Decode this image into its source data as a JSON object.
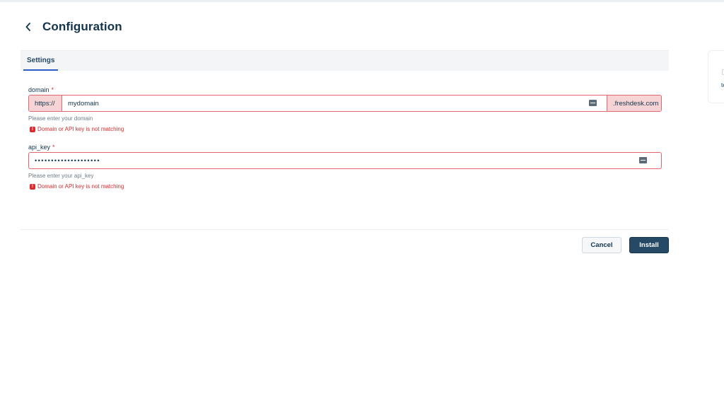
{
  "header": {
    "title": "Configuration",
    "back_icon": "chevron-left-icon"
  },
  "tabs": [
    {
      "label": "Settings",
      "active": true
    }
  ],
  "fields": {
    "domain": {
      "label": "domain",
      "required_mark": "*",
      "prefix": "https://",
      "value": "mydomain",
      "suffix": ".freshdesk.com",
      "hint": "Please enter your domain",
      "error": "Domain or API key is not matching"
    },
    "api_key": {
      "label": "api_key",
      "required_mark": "*",
      "value": "••••••••••••••••••••",
      "hint": "Please enter your api_key",
      "error": "Domain or API key is not matching"
    }
  },
  "error_icon_glyph": "!",
  "actions": {
    "cancel_label": "Cancel",
    "install_label": "Install"
  },
  "side_panel": {
    "text": "te"
  },
  "colors": {
    "primary_text": "#12344d",
    "error": "#d72d30",
    "error_bg": "#f6d4d5",
    "tab_active": "#2c5cc5",
    "install_bg": "#264966"
  }
}
